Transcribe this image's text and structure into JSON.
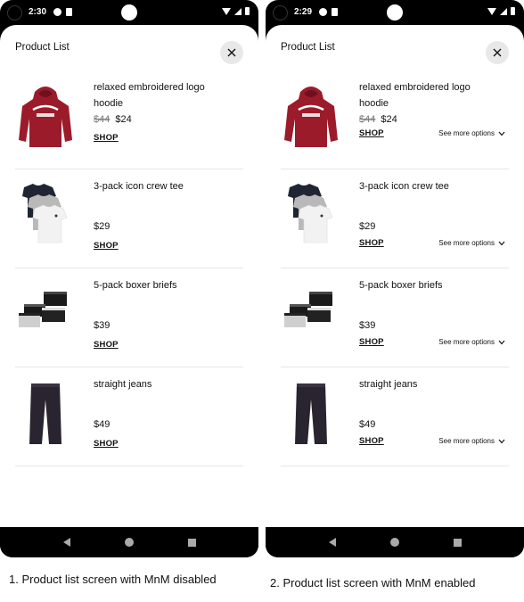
{
  "screens": [
    {
      "time": "2:30",
      "title": "Product List",
      "mnm_enabled": false,
      "items": [
        {
          "name": "relaxed embroidered logo hoodie",
          "old_price": "$44",
          "price": "$24",
          "shop": "SHOP",
          "image": "red-hoodie-icon"
        },
        {
          "name": "3-pack icon crew tee",
          "old_price": "",
          "price": "$29",
          "shop": "SHOP",
          "image": "tee-pack-icon"
        },
        {
          "name": "5-pack boxer briefs",
          "old_price": "",
          "price": "$39",
          "shop": "SHOP",
          "image": "boxer-pack-icon"
        },
        {
          "name": "straight jeans",
          "old_price": "",
          "price": "$49",
          "shop": "SHOP",
          "image": "jeans-icon"
        }
      ]
    },
    {
      "time": "2:29",
      "title": "Product List",
      "mnm_enabled": true,
      "see_more": "See more options",
      "items": [
        {
          "name": "relaxed embroidered logo hoodie",
          "old_price": "$44",
          "price": "$24",
          "shop": "SHOP",
          "image": "red-hoodie-icon"
        },
        {
          "name": "3-pack icon crew tee",
          "old_price": "",
          "price": "$29",
          "shop": "SHOP",
          "image": "tee-pack-icon"
        },
        {
          "name": "5-pack boxer briefs",
          "old_price": "",
          "price": "$39",
          "shop": "SHOP",
          "image": "boxer-pack-icon"
        },
        {
          "name": "straight jeans",
          "old_price": "",
          "price": "$49",
          "shop": "SHOP",
          "image": "jeans-icon"
        }
      ]
    }
  ],
  "captions": [
    "1. Product list screen with MnM disabled",
    "2. Product list screen with MnM enabled"
  ],
  "colors": {
    "hoodie": "#9c1b2b",
    "tee_dark": "#1f2533",
    "tee_grey": "#b9b9b9",
    "jeans": "#2a2430"
  }
}
